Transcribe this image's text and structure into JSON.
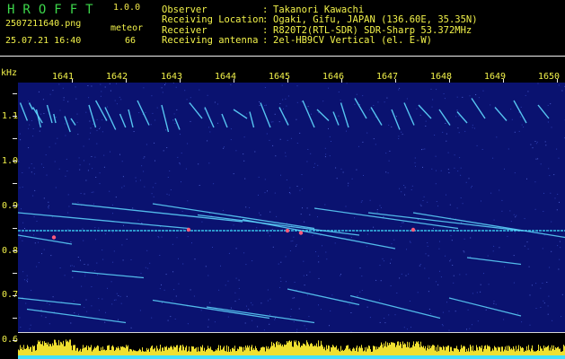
{
  "header": {
    "app_name": "HROFFT",
    "version": "1.0.0",
    "filename": "2507211640.png",
    "mode": "meteor",
    "datetime": "25.07.21 16:40",
    "count": "66"
  },
  "info": [
    {
      "label": "Observer",
      "value": "Takanori Kawachi"
    },
    {
      "label": "Receiving Location",
      "value": "Ogaki, Gifu, JAPAN (136.60E, 35.35N)"
    },
    {
      "label": "Receiver",
      "value": "R820T2(RTL-SDR) SDR-Sharp 53.372MHz"
    },
    {
      "label": "Receiving antenna",
      "value": "2el-HB9CV Vertical (el. E-W)"
    }
  ],
  "axes": {
    "unit": "kHz",
    "minute_labels": [
      "1641",
      "1642",
      "1643",
      "1644",
      "1645",
      "1646",
      "1647",
      "1648",
      "1649",
      "1650"
    ],
    "freq_labels": [
      "1.1",
      "1.0",
      "0.9",
      "0.8",
      "0.7",
      "0.6"
    ],
    "colors": {
      "background": "#0a1270",
      "text": "#f2f24a",
      "trace": "#5fd8ff",
      "hot": "#ff5a7a",
      "noise": "#f0e030",
      "baseline": "#40e0ff"
    }
  },
  "chart_data": {
    "type": "spectrogram",
    "title": "",
    "xlabel": "",
    "ylabel": "kHz",
    "x_range": [
      "16:40",
      "16:50"
    ],
    "ylim": [
      0.6,
      1.2
    ],
    "carrier_kHz": 0.87,
    "meteor_count": 66,
    "echoes": [
      {
        "t0": 16.7,
        "f0": 1.145,
        "t1": 27.2,
        "f1": 1.11
      },
      {
        "t0": 2.5,
        "f0": 1.155,
        "t1": 10.4,
        "f1": 1.115
      },
      {
        "t0": 12.5,
        "f0": 1.155,
        "t1": 16.3,
        "f1": 1.14
      },
      {
        "t0": 20.5,
        "f0": 1.14,
        "t1": 25.3,
        "f1": 1.1
      },
      {
        "t0": 32.5,
        "f0": 1.15,
        "t1": 38.0,
        "f1": 1.11
      },
      {
        "t0": 39.8,
        "f0": 1.13,
        "t1": 42.0,
        "f1": 1.11
      },
      {
        "t0": 52.0,
        "f0": 1.125,
        "t1": 58.2,
        "f1": 1.09
      },
      {
        "t0": 59.0,
        "f0": 1.12,
        "t1": 64.0,
        "f1": 1.105
      },
      {
        "t0": 79.0,
        "f0": 1.15,
        "t1": 86.5,
        "f1": 1.1
      },
      {
        "t0": 86.6,
        "f0": 1.16,
        "t1": 98.9,
        "f1": 1.115
      },
      {
        "t0": 97.0,
        "f0": 1.145,
        "t1": 108.7,
        "f1": 1.095
      },
      {
        "t0": 113.5,
        "f0": 1.13,
        "t1": 119.8,
        "f1": 1.1
      },
      {
        "t0": 123.0,
        "f0": 1.14,
        "t1": 128.0,
        "f1": 1.1
      },
      {
        "t0": 133.0,
        "f0": 1.16,
        "t1": 146.0,
        "f1": 1.105
      },
      {
        "t0": 160.0,
        "f0": 1.15,
        "t1": 167.5,
        "f1": 1.09
      },
      {
        "t0": 175.0,
        "f0": 1.12,
        "t1": 180.0,
        "f1": 1.095
      },
      {
        "t0": 191.0,
        "f0": 1.155,
        "t1": 205.0,
        "f1": 1.12
      },
      {
        "t0": 208.0,
        "f0": 1.145,
        "t1": 218.0,
        "f1": 1.1
      },
      {
        "t0": 227.0,
        "f0": 1.13,
        "t1": 233.0,
        "f1": 1.1
      },
      {
        "t0": 240.0,
        "f0": 1.14,
        "t1": 255.0,
        "f1": 1.12
      },
      {
        "t0": 258.0,
        "f0": 1.135,
        "t1": 262.5,
        "f1": 1.1
      },
      {
        "t0": 270.0,
        "f0": 1.155,
        "t1": 281.0,
        "f1": 1.1
      },
      {
        "t0": 291.0,
        "f0": 1.145,
        "t1": 301.0,
        "f1": 1.105
      },
      {
        "t0": 317.0,
        "f0": 1.16,
        "t1": 330.0,
        "f1": 1.1
      },
      {
        "t0": 333.0,
        "f0": 1.14,
        "t1": 346.0,
        "f1": 1.115
      },
      {
        "t0": 351.0,
        "f0": 1.135,
        "t1": 357.0,
        "f1": 1.105
      },
      {
        "t0": 359.5,
        "f0": 1.155,
        "t1": 368.0,
        "f1": 1.1
      },
      {
        "t0": 375.0,
        "f0": 1.165,
        "t1": 388.0,
        "f1": 1.12
      },
      {
        "t0": 393.0,
        "f0": 1.145,
        "t1": 405.0,
        "f1": 1.105
      },
      {
        "t0": 416.0,
        "f0": 1.14,
        "t1": 425.0,
        "f1": 1.095
      },
      {
        "t0": 430.0,
        "f0": 1.155,
        "t1": 441.0,
        "f1": 1.105
      },
      {
        "t0": 446.0,
        "f0": 1.15,
        "t1": 460.0,
        "f1": 1.12
      },
      {
        "t0": 469.0,
        "f0": 1.14,
        "t1": 481.0,
        "f1": 1.105
      },
      {
        "t0": 489.0,
        "f0": 1.135,
        "t1": 500.0,
        "f1": 1.11
      },
      {
        "t0": 505.0,
        "f0": 1.165,
        "t1": 520.0,
        "f1": 1.12
      },
      {
        "t0": 531.0,
        "f0": 1.145,
        "t1": 544.0,
        "f1": 1.115
      },
      {
        "t0": 552.0,
        "f0": 1.16,
        "t1": 566.0,
        "f1": 1.11
      },
      {
        "t0": 579.0,
        "f0": 1.15,
        "t1": 591.0,
        "f1": 1.12
      }
    ]
  }
}
